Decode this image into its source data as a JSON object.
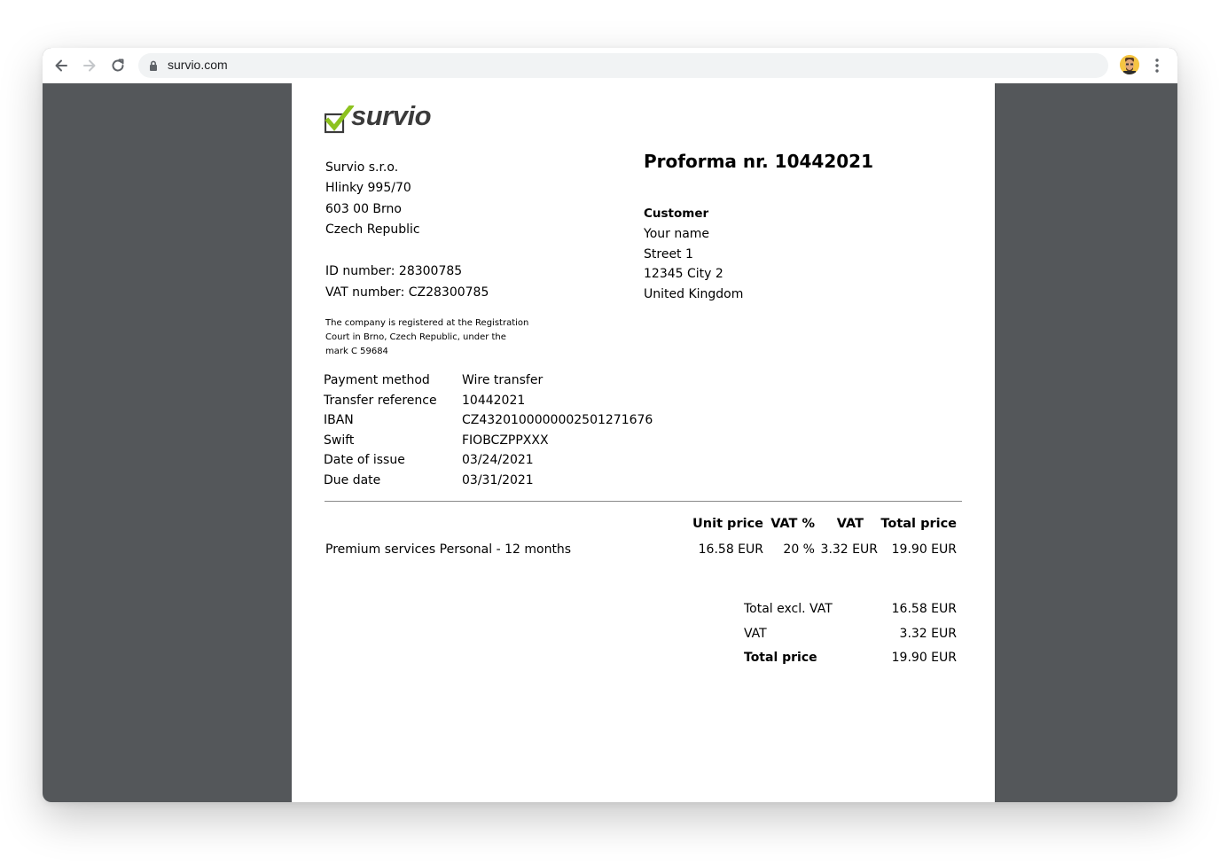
{
  "browser": {
    "url": "survio.com"
  },
  "invoice": {
    "logo_text": "survio",
    "company": [
      "Survio s.r.o.",
      "Hlinky 995/70",
      "603 00 Brno",
      "Czech Republic"
    ],
    "id_number": "ID number: 28300785",
    "vat_number": "VAT number: CZ28300785",
    "registration_note": "The company is registered at the Registration Court in Brno, Czech Republic, under the mark C 59684",
    "title": "Proforma nr. 10442021",
    "customer": {
      "label": "Customer",
      "lines": [
        "Your name",
        "Street 1",
        "12345 City 2",
        "United Kingdom"
      ]
    },
    "payment": [
      {
        "label": "Payment method",
        "value": "Wire transfer"
      },
      {
        "label": "Transfer reference",
        "value": "10442021"
      },
      {
        "label": "IBAN",
        "value": "CZ4320100000002501271676"
      },
      {
        "label": "Swift",
        "value": "FIOBCZPPXXX"
      },
      {
        "label": "Date of issue",
        "value": "03/24/2021"
      },
      {
        "label": "Due date",
        "value": "03/31/2021"
      }
    ],
    "table": {
      "headers": {
        "unit_price": "Unit price",
        "vat_pct": "VAT %",
        "vat": "VAT",
        "total": "Total price"
      },
      "rows": [
        {
          "description": "Premium services Personal - 12 months",
          "unit_price": "16.58 EUR",
          "vat_pct": "20 %",
          "vat": "3.32 EUR",
          "total": "19.90 EUR"
        }
      ]
    },
    "totals": [
      {
        "label": "Total excl. VAT",
        "value": "16.58 EUR"
      },
      {
        "label": "VAT",
        "value": "3.32 EUR"
      },
      {
        "label": "Total price",
        "value": "19.90 EUR"
      }
    ]
  },
  "colors": {
    "viewer_background": "#54575a",
    "logo_check_green": "#8dc21f",
    "logo_text": "#3b3b3b"
  }
}
